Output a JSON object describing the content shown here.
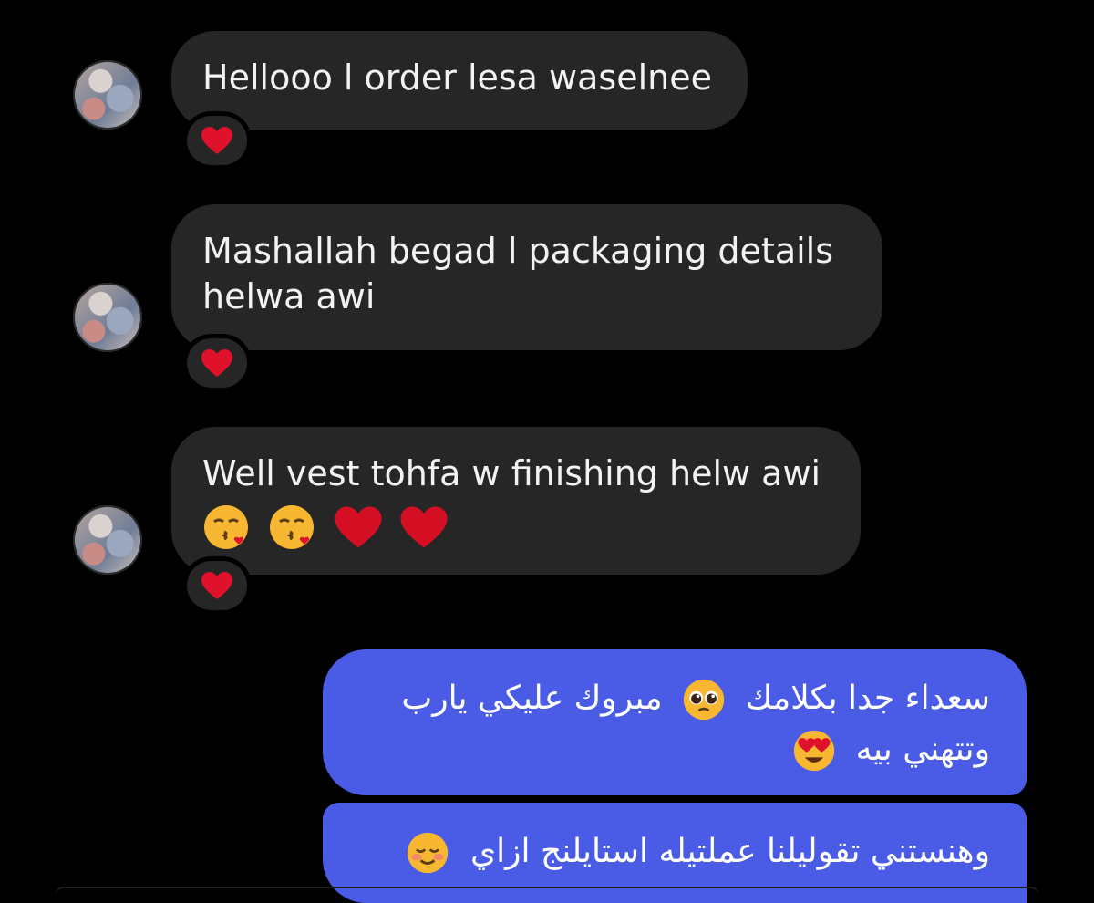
{
  "messages_in": [
    {
      "lines": [
        "Hellooo l order lesa waselnee"
      ],
      "reaction": "red-heart"
    },
    {
      "lines": [
        "Mashallah begad l packaging details",
        "helwa awi"
      ],
      "reaction": "red-heart"
    },
    {
      "lines": [
        "Well vest tohfa w finishing helw awi"
      ],
      "emojis": [
        "kissing-face-with-heart",
        "kissing-face-with-heart",
        "red-heart",
        "red-heart"
      ],
      "reaction": "red-heart"
    }
  ],
  "messages_out": [
    {
      "line1": "سعداء جدا بكلامك",
      "line1b": "مبروك عليكي يارب",
      "line2": "وتتهني بيه",
      "emoji1": "pleading-face",
      "emoji2": "heart-eyes-face"
    },
    {
      "line1": "وهنستني تقوليلنا عملتيله استايلنج ازاي",
      "emoji1": "smiling-blushing-face"
    }
  ],
  "colors": {
    "incoming_bubble": "#262626",
    "outgoing_bubble": "#4a5be6",
    "background": "#000000",
    "heart": "#e0112a"
  }
}
